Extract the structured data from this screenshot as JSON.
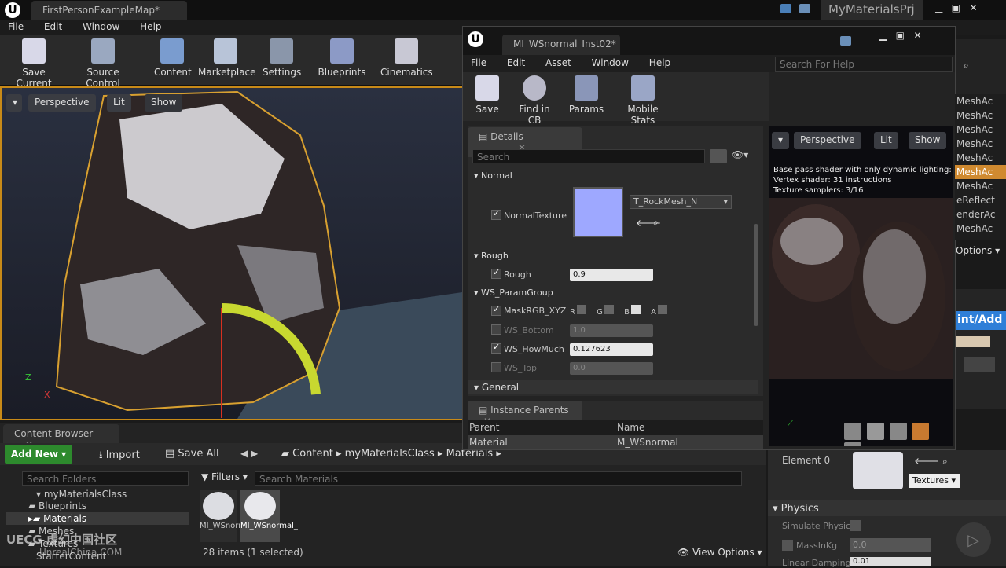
{
  "main": {
    "tab_title": "FirstPersonExampleMap*",
    "project_name": "MyMaterialsPrj",
    "menu": [
      "File",
      "Edit",
      "Window",
      "Help"
    ],
    "toolbar": [
      {
        "label": "Save Current",
        "icon": "save-icon"
      },
      {
        "label": "Source Control",
        "icon": "source-control-icon"
      },
      {
        "label": "Content",
        "icon": "content-icon"
      },
      {
        "label": "Marketplace",
        "icon": "marketplace-icon"
      },
      {
        "label": "Settings",
        "icon": "settings-icon"
      },
      {
        "label": "Blueprints",
        "icon": "blueprints-icon"
      },
      {
        "label": "Cinematics",
        "icon": "cinematics-icon"
      }
    ],
    "viewport": {
      "perspective": "Perspective",
      "lit": "Lit",
      "show": "Show"
    }
  },
  "content_browser": {
    "tab": "Content Browser",
    "add_new": "Add New",
    "import": "Import",
    "save_all": "Save All",
    "path": [
      "Content",
      "myMaterialsClass",
      "Materials"
    ],
    "search_folders": "Search Folders",
    "filters": "Filters",
    "search_materials": "Search Materials",
    "folders": [
      {
        "name": "myMaterialsClass",
        "indent": 1
      },
      {
        "name": "Blueprints",
        "indent": 2
      },
      {
        "name": "Materials",
        "indent": 2,
        "selected": true
      },
      {
        "name": "Meshes",
        "indent": 2
      },
      {
        "name": "Textures",
        "indent": 2
      },
      {
        "name": "StarterContent",
        "indent": 1
      }
    ],
    "assets": [
      {
        "name": "MI_WSnormal_",
        "selected": false
      },
      {
        "name": "MI_WSnormal_",
        "selected": true
      }
    ],
    "items_count": "28 items (1 selected)",
    "view_options": "View Options"
  },
  "mie": {
    "tab_title": "MI_WSnormal_Inst02*",
    "menu": [
      "File",
      "Edit",
      "Asset",
      "Window",
      "Help"
    ],
    "search_help": "Search For Help",
    "toolbar": [
      {
        "label": "Save",
        "icon": "save-icon"
      },
      {
        "label": "Find in CB",
        "icon": "find-icon"
      },
      {
        "label": "Params",
        "icon": "params-icon"
      },
      {
        "label": "Mobile Stats",
        "icon": "mobile-stats-icon"
      }
    ],
    "details_tab": "Details",
    "search": "Search",
    "groups": {
      "normal": "Normal",
      "rough": "Rough",
      "ws": "WS_ParamGroup",
      "general": "General"
    },
    "params": {
      "normal_texture": {
        "label": "NormalTexture",
        "asset": "T_RockMesh_N"
      },
      "rough": {
        "label": "Rough",
        "value": "0.9"
      },
      "mask": {
        "label": "MaskRGB_XYZ",
        "channels": [
          "R",
          "G",
          "B",
          "A"
        ]
      },
      "ws_bottom": {
        "label": "WS_Bottom",
        "value": "1.0"
      },
      "ws_howmuch": {
        "label": "WS_HowMuch",
        "value": "0.127623"
      },
      "ws_top": {
        "label": "WS_Top",
        "value": "0.0"
      }
    },
    "instance_parents": {
      "tab": "Instance Parents",
      "headers": [
        "Parent",
        "Name"
      ],
      "row": [
        "Material",
        "M_WSnormal"
      ]
    },
    "preview": {
      "perspective": "Perspective",
      "lit": "Lit",
      "show": "Show",
      "stats": [
        "Base pass shader with only dynamic lighting:",
        "Vertex shader: 31 instructions",
        "Texture samplers: 3/16"
      ]
    }
  },
  "right_panel": {
    "mesh_items": [
      "MeshAc",
      "MeshAc",
      "MeshAc",
      "MeshAc",
      "MeshAc",
      "MeshAc",
      "MeshAc",
      "eReflect",
      "enderAc",
      "MeshAc"
    ],
    "options": "Options",
    "add_button": "int/Add",
    "element": "Element 0",
    "textures": "Textures",
    "physics": "Physics",
    "simulate": "Simulate Physic",
    "mass_label": "MassInKg",
    "mass_value": "0.0",
    "linear_damping": "Linear Damping",
    "linear_value": "0.01"
  },
  "watermark": {
    "text": "UECG 虚幻中国社区",
    "url": "UnrealChina.COM"
  }
}
